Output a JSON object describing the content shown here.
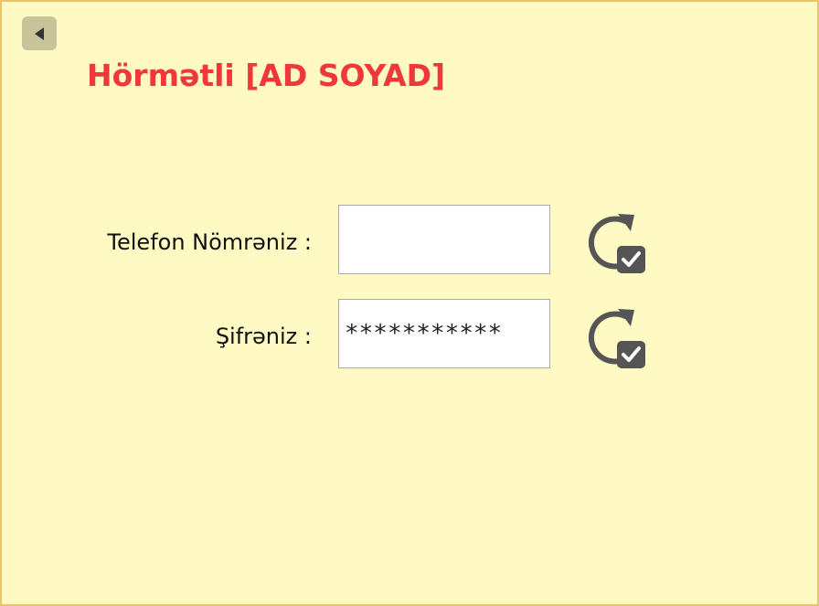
{
  "header": {
    "back_icon": "back-arrow-icon",
    "title": "Hörmətli [AD SOYAD]"
  },
  "form": {
    "phone": {
      "label": "Telefon Nömrəniz :",
      "value": "",
      "refresh_icon": "refresh-check-icon"
    },
    "password": {
      "label": "Şifrəniz :",
      "value": "***********",
      "refresh_icon": "refresh-check-icon"
    }
  },
  "colors": {
    "background": "#fff9c4",
    "border": "#e8c56a",
    "title": "#f0373a",
    "icon": "#555555"
  }
}
